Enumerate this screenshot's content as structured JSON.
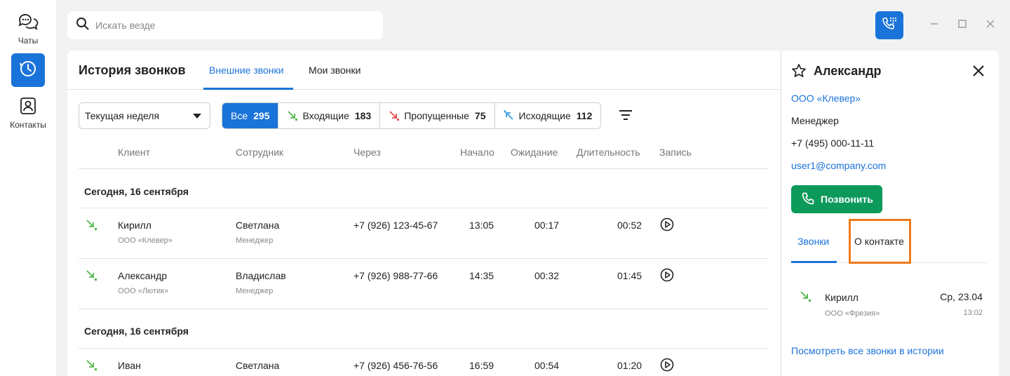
{
  "nav": {
    "chats_label": "Чаты",
    "contacts_label": "Контакты"
  },
  "search": {
    "placeholder": "Искать везде"
  },
  "header": {
    "title": "История звонков",
    "tabs": [
      {
        "label": "Внешние звонки",
        "active": true
      },
      {
        "label": "Мои звонки",
        "active": false
      }
    ]
  },
  "period": {
    "value": "Текущая неделя"
  },
  "filters": [
    {
      "label": "Все",
      "count": "295",
      "active": true,
      "icon": "all"
    },
    {
      "label": "Входящие",
      "count": "183",
      "active": false,
      "icon": "incoming-call-icon"
    },
    {
      "label": "Пропущенные",
      "count": "75",
      "active": false,
      "icon": "missed-call-icon"
    },
    {
      "label": "Исходящие",
      "count": "112",
      "active": false,
      "icon": "outgoing-call-icon"
    }
  ],
  "columns": [
    "Клиент",
    "Сотрудник",
    "Через",
    "Начало",
    "Ожидание",
    "Длительность",
    "Запись"
  ],
  "groups": [
    {
      "title": "Сегодня, 16 сентября",
      "rows": [
        {
          "direction": "incoming",
          "client": "Кирилл",
          "client_company": "ООО «Клевер»",
          "employee": "Светлана",
          "employee_role": "Менеджер",
          "via": "+7 (926) 123-45-67",
          "start": "13:05",
          "wait": "00:17",
          "duration": "00:52"
        },
        {
          "direction": "incoming",
          "client": "Александр",
          "client_company": "ООО «Лютик»",
          "employee": "Владислав",
          "employee_role": "Менеджер",
          "via": "+7 (926) 988-77-66",
          "start": "14:35",
          "wait": "00:32",
          "duration": "01:45"
        }
      ]
    },
    {
      "title": "Сегодня, 16 сентября",
      "rows": [
        {
          "direction": "incoming",
          "client": "Иван",
          "employee": "Светлана",
          "via": "+7 (926) 456-76-56",
          "start": "16:59",
          "wait": "00:54",
          "duration": "01:20"
        }
      ]
    }
  ],
  "contact": {
    "name": "Александр",
    "company": "ООО «Клевер»",
    "position": "Менеджер",
    "phone": "+7 (495) 000-11-11",
    "email": "user1@company.com",
    "call_label": "Позвонить",
    "tabs": [
      {
        "label": "Звонки",
        "active": true
      },
      {
        "label": "О контакте",
        "active": false
      }
    ],
    "calls": [
      {
        "direction": "incoming",
        "name": "Кирилл",
        "company": "ООО «Фрезия»",
        "date": "Ср, 23.04",
        "time": "13:02"
      }
    ],
    "view_all": "Посмотреть все звонки в истории"
  },
  "colors": {
    "accent": "#1a73d8",
    "call_green": "#0b9a5a",
    "incoming": "#52b848",
    "missed": "#e5484d",
    "outgoing": "#3aa0e0",
    "highlight": "#f07a1a"
  }
}
